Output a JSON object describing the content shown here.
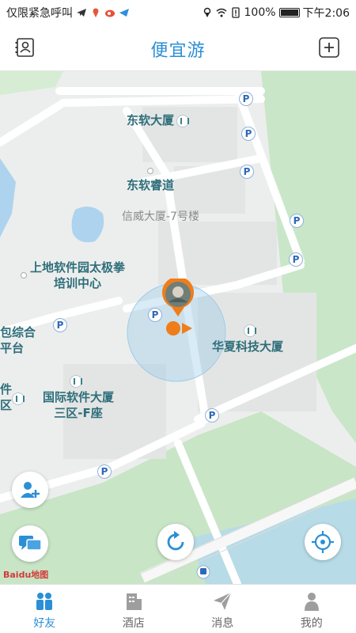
{
  "status_bar": {
    "carrier": "仅限紧急呼叫",
    "battery": "100%",
    "time": "下午2:06"
  },
  "header": {
    "title": "便宜游",
    "left_icon": "contacts-icon",
    "right_icon": "add-square-icon"
  },
  "map": {
    "pois": [
      {
        "name": "东软大厦"
      },
      {
        "name": "东软睿道"
      },
      {
        "name": "信威大厦-7号楼"
      },
      {
        "name": "上地软件园太极拳"
      },
      {
        "name": "培训中心"
      },
      {
        "name": "包综合"
      },
      {
        "name": "平台"
      },
      {
        "name": "华夏科技大厦"
      },
      {
        "name": "件"
      },
      {
        "name": "区"
      },
      {
        "name": "国际软件大厦"
      },
      {
        "name": "三区-F座"
      }
    ],
    "parking_label": "P",
    "attribution": "Baidu地图"
  },
  "buttons": {
    "add_friend_icon": "add-user-icon",
    "chat_icon": "chat-icon",
    "refresh_icon": "refresh-icon",
    "locate_icon": "locate-icon"
  },
  "tabs": [
    {
      "label": "好友",
      "icon": "friends-icon",
      "active": true
    },
    {
      "label": "酒店",
      "icon": "hotel-icon",
      "active": false
    },
    {
      "label": "消息",
      "icon": "message-icon",
      "active": false
    },
    {
      "label": "我的",
      "icon": "profile-icon",
      "active": false
    }
  ],
  "colors": {
    "accent": "#2b8fd6",
    "tab_inactive": "#9e9e9e",
    "location_orange": "#ef7d1a"
  }
}
